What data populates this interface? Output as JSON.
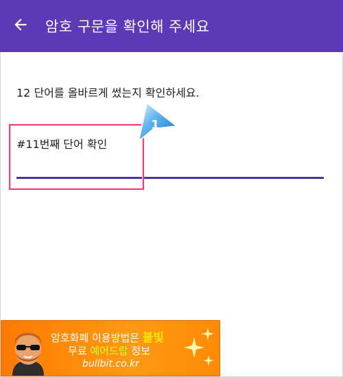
{
  "colors": {
    "appbar": "#5c3ab7",
    "underline": "#4a3596",
    "highlight": "#ee3f7a",
    "banner": "#ff8a05",
    "callout": "#2f8ee0"
  },
  "appbar": {
    "back_icon": "arrow-left-icon",
    "title": "암호 구문을 확인해 주세요"
  },
  "main": {
    "instruction": "12 단어를 올바르게 썼는지 확인하세요.",
    "field_label": "#11번째 단어 확인",
    "field_value": ""
  },
  "callout": {
    "number": "1"
  },
  "banner": {
    "line1_prefix": "암호화폐 이용방법은 ",
    "line1_highlight": "불빛",
    "line2_prefix": "무료 ",
    "line2_highlight": "예어드랍",
    "line2_suffix": " 정보",
    "site": "bullbit.co.kr"
  }
}
